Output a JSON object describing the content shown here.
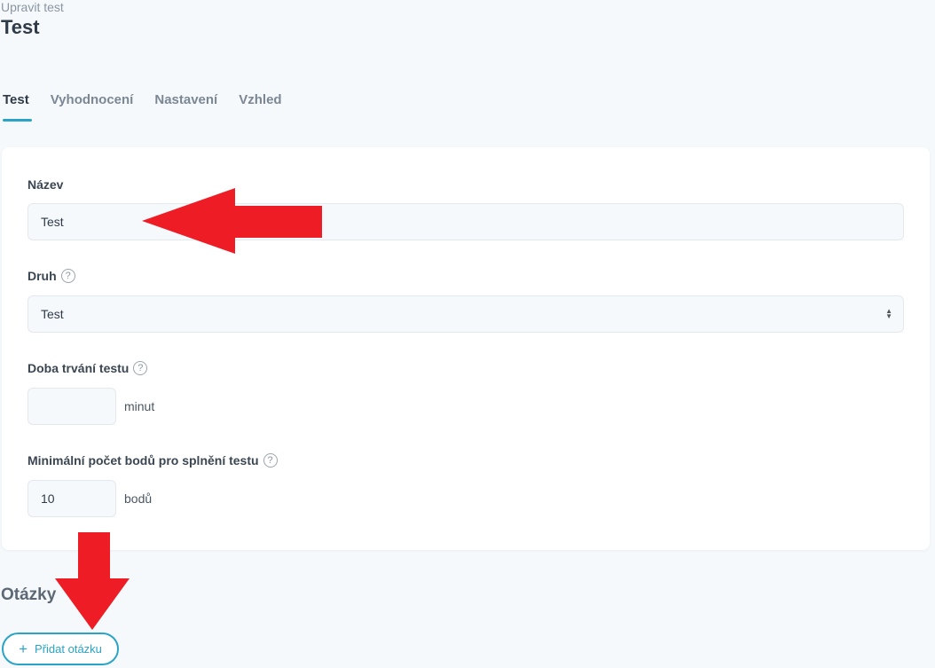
{
  "header": {
    "breadcrumb": "Upravit test",
    "title": "Test"
  },
  "tabs": [
    {
      "label": "Test",
      "active": true
    },
    {
      "label": "Vyhodnocení",
      "active": false
    },
    {
      "label": "Nastavení",
      "active": false
    },
    {
      "label": "Vzhled",
      "active": false
    }
  ],
  "form": {
    "name": {
      "label": "Název",
      "value": "Test"
    },
    "type": {
      "label": "Druh",
      "help": "?",
      "selected": "Test"
    },
    "duration": {
      "label": "Doba trvání testu",
      "help": "?",
      "value": "",
      "unit": "minut"
    },
    "min_points": {
      "label": "Minimální počet bodů pro splnění testu",
      "help": "?",
      "value": "10",
      "unit": "bodů"
    }
  },
  "questions": {
    "title": "Otázky",
    "add_button": {
      "icon": "plus-icon",
      "label": "Přidat otázku"
    }
  },
  "annotations": {
    "arrow_color": "#ee1c25"
  },
  "colors": {
    "accent": "#2aa4c6",
    "background": "#f6f9fc"
  }
}
